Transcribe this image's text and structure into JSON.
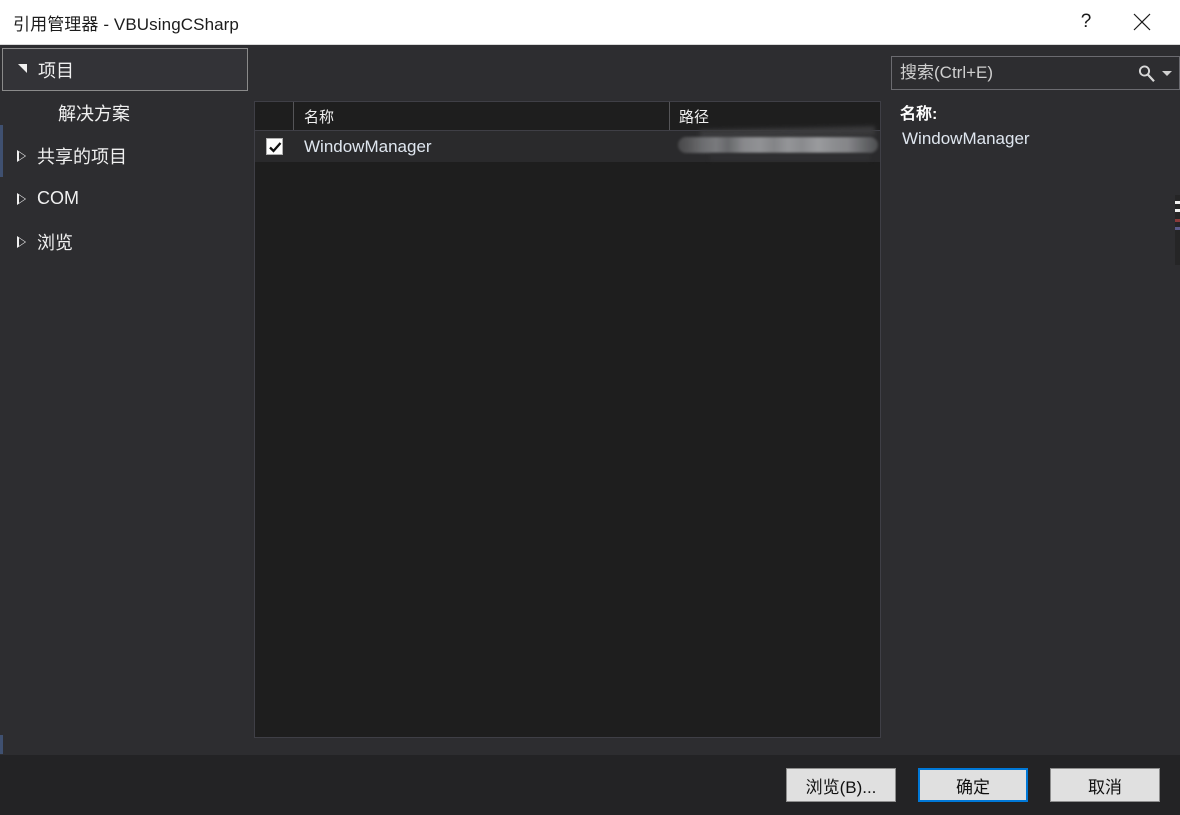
{
  "window": {
    "title": "引用管理器 - VBUsingCSharp",
    "help_button": "?",
    "close_button": "×"
  },
  "sidebar": {
    "items": [
      {
        "label": "项目",
        "icon": "chevron-down-icon",
        "selected": true,
        "indent": false
      },
      {
        "label": "解决方案",
        "icon": "none",
        "selected": false,
        "indent": true
      },
      {
        "label": "共享的项目",
        "icon": "chevron-right-icon",
        "selected": false,
        "indent": false
      },
      {
        "label": "COM",
        "icon": "chevron-right-icon",
        "selected": false,
        "indent": false
      },
      {
        "label": "浏览",
        "icon": "chevron-right-icon",
        "selected": false,
        "indent": false
      }
    ]
  },
  "list": {
    "columns": [
      "名称",
      "路径"
    ],
    "rows": [
      {
        "checked": true,
        "name": "WindowManager",
        "path": "",
        "path_redacted": true
      }
    ]
  },
  "search": {
    "placeholder": "搜索(Ctrl+E)",
    "value": "",
    "icon": "search-icon",
    "dropdown_icon": "chevron-down-icon"
  },
  "details": {
    "name_label": "名称:",
    "name_value": "WindowManager"
  },
  "footer": {
    "browse_label": "浏览(B)...",
    "ok_label": "确定",
    "cancel_label": "取消"
  },
  "colors": {
    "dialog_bg": "#2d2d30",
    "panel_bg": "#1e1e1e",
    "titlebar_bg": "#ffffff",
    "accent": "#0078d7",
    "text": "#f0f0f0",
    "value_text": "#dfe6ef"
  }
}
